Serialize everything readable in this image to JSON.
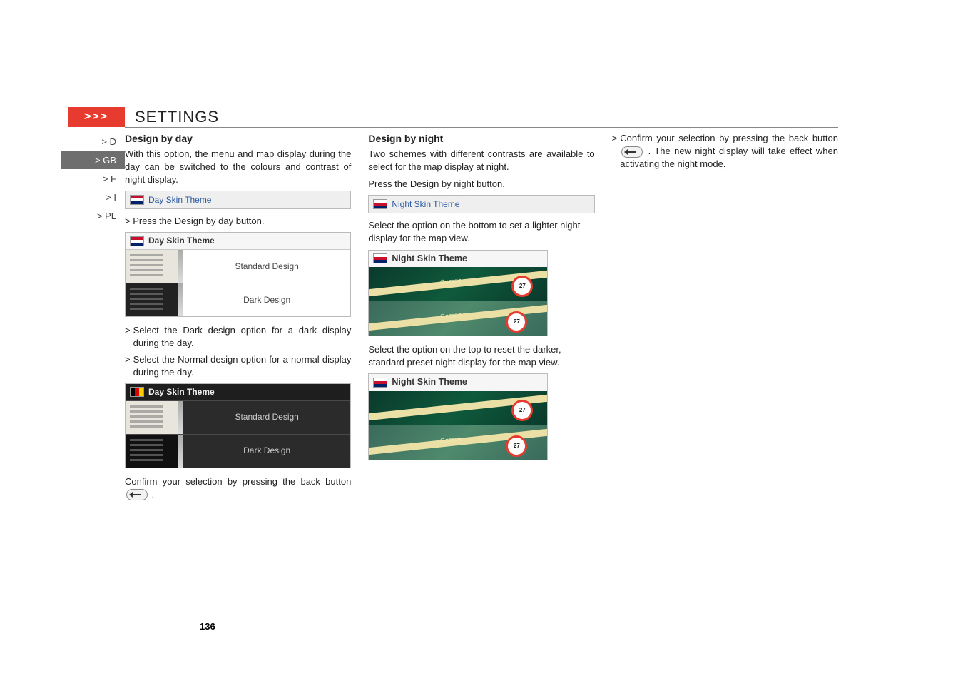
{
  "chevron": ">>>",
  "section_title": "SETTINGS",
  "sidebar": {
    "items": [
      "> D",
      "> GB",
      "> F",
      "> I",
      "> PL"
    ],
    "active_index": 1
  },
  "col1": {
    "subheading": "Design by day",
    "para1": "With this option, the menu and map display during the day can be switched to the colours and contrast of night display.",
    "bar_label": "Day Skin Theme",
    "press_text": "> Press the Design by day button.",
    "card_header": "Day Skin Theme",
    "option_standard": "Standard Design",
    "option_dark": "Dark Design",
    "bullet1": "Select the Dark design option for a dark display during the day.",
    "bullet2": "Select the Normal design option for a normal display during the day.",
    "confirm_text_a": "Confirm your selection by pressing the back button ",
    "confirm_text_b": "."
  },
  "col2": {
    "subheading": "Design by night",
    "para1": "Two schemes with different contrasts are available to select for the map display at night.",
    "para2": "Press the Design by night button.",
    "bar_label": "Night Skin Theme",
    "para3": "Select the option on the bottom to set a lighter night display for the map view.",
    "card_header": "Night Skin Theme",
    "speed_a": "27",
    "speed_b": "27",
    "road_label": "Goerde",
    "para4": "Select the option on the top to reset the darker, standard preset night display for the map view."
  },
  "col3": {
    "text_a": "Confirm your selection by pressing the back button ",
    "text_b": ". The new night display will take effect when activating the night mode."
  },
  "page_number": "136"
}
